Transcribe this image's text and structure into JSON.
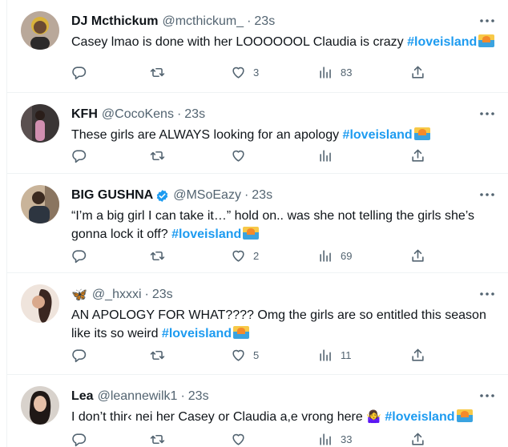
{
  "tweets": [
    {
      "name": "DJ Mcthickum",
      "handle": "@mcthickum_",
      "time": "23s",
      "text": "Casey lmao is done with her LOOOOOOL Claudia is crazy ",
      "hashtag": "#loveisland",
      "replies": "",
      "retweets": "",
      "likes": "3",
      "views": "83"
    },
    {
      "name": "KFH",
      "handle": "@CocoKens",
      "time": "23s",
      "text": "These girls are ALWAYS looking for an apology ",
      "hashtag": "#loveisland",
      "replies": "",
      "retweets": "",
      "likes": "",
      "views": ""
    },
    {
      "name": "BIG GUSHNA",
      "handle": "@MSoEazy",
      "time": "23s",
      "verified": true,
      "text": "“I’m a big girl I can take it…” hold on.. was she not telling the girls she’s gonna lock it off? ",
      "hashtag": "#loveisland",
      "replies": "",
      "retweets": "",
      "likes": "2",
      "views": "69"
    },
    {
      "name": "",
      "name_emoji": "🦋",
      "handle": "@_hxxxi",
      "time": "23s",
      "text": "AN APOLOGY FOR WHAT???? Omg the girls are so entitled this season like its so weird ",
      "hashtag": "#loveisland",
      "replies": "",
      "retweets": "",
      "likes": "5",
      "views": "11"
    },
    {
      "name": "Lea",
      "handle": "@leannewilk1",
      "time": "23s",
      "text": "I don’t thir‹ nei her Casey or Claudia a,e vrong here ",
      "text_emoji": "🤷‍♀️",
      "hashtag": "#loveisland",
      "replies": "",
      "retweets": "",
      "likes": "",
      "views": "33"
    }
  ],
  "colors": {
    "accent": "#1d9bf0",
    "text": "#0f1419",
    "muted": "#536471",
    "divider": "#eff3f4"
  },
  "icons": {
    "reply": "reply-icon",
    "retweet": "retweet-icon",
    "like": "heart-icon",
    "views": "views-icon",
    "share": "share-icon",
    "more": "more-icon",
    "verified": "verified-badge-icon"
  }
}
